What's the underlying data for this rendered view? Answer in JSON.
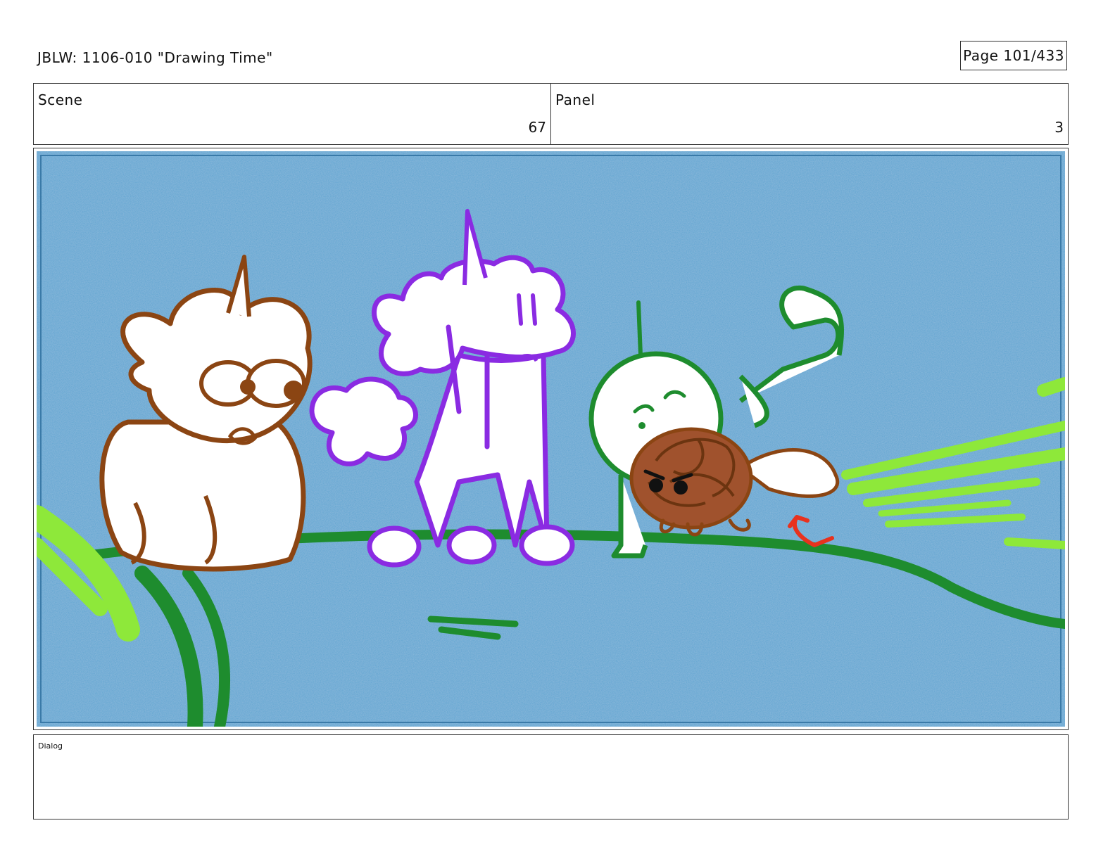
{
  "header": {
    "title": "JBLW: 1106-010 \"Drawing Time\"",
    "page": "Page 101/433"
  },
  "scene": {
    "label": "Scene",
    "value": "67"
  },
  "panel": {
    "label": "Panel",
    "value": "3"
  },
  "dialog": {
    "label": "Dialog"
  },
  "artwork": {
    "background_color": "#5aa3d0",
    "characters": [
      "brown-bear-unicorn",
      "purple-unicorn",
      "green-stick-figure",
      "brown-fuzzy-creature"
    ],
    "colors": {
      "brown": "#8b4513",
      "purple": "#8a2be2",
      "dark_green": "#1e8c2e",
      "light_green": "#8ee83a",
      "red": "#e8321e"
    }
  }
}
